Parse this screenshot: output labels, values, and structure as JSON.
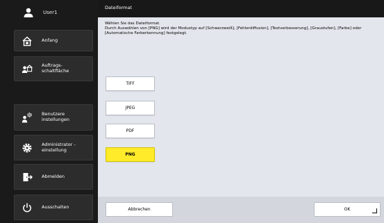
{
  "user": {
    "name": "User1",
    "icon": "user-icon"
  },
  "sidebar": {
    "items": [
      {
        "label": "Anfang",
        "icon": "home-icon"
      },
      {
        "label": "Auftrags-\nschaltfläche",
        "icon": "job-button-icon"
      },
      {
        "label": "Benutzere instellungen",
        "icon": "user-settings-icon"
      },
      {
        "label": "Administrator -\neinstellung",
        "icon": "admin-gear-icon"
      },
      {
        "label": "Abmelden",
        "icon": "logout-icon"
      },
      {
        "label": "Ausschalten",
        "icon": "power-icon"
      }
    ]
  },
  "dialog": {
    "title": "Dateiformat",
    "description": "Wählen Sie das Dateiformat.\nDurch Auswählen von [PNG] wird der Modustyp auf [Schwarzweiß], [Fehlerdiffusion], [Textverbesserung], [Graustufen], [Farbe] oder [Automatische Farberkennung] festgelegt.",
    "formats": [
      "TIFF",
      "JPEG",
      "PDF",
      "PNG"
    ],
    "selected_format": "PNG",
    "cancel_label": "Abbrechen",
    "ok_label": "OK"
  },
  "colors": {
    "selected": "#ffeb2a",
    "sidebar_bg": "#1a1a1a",
    "panel_bg": "#e3e6ec"
  }
}
